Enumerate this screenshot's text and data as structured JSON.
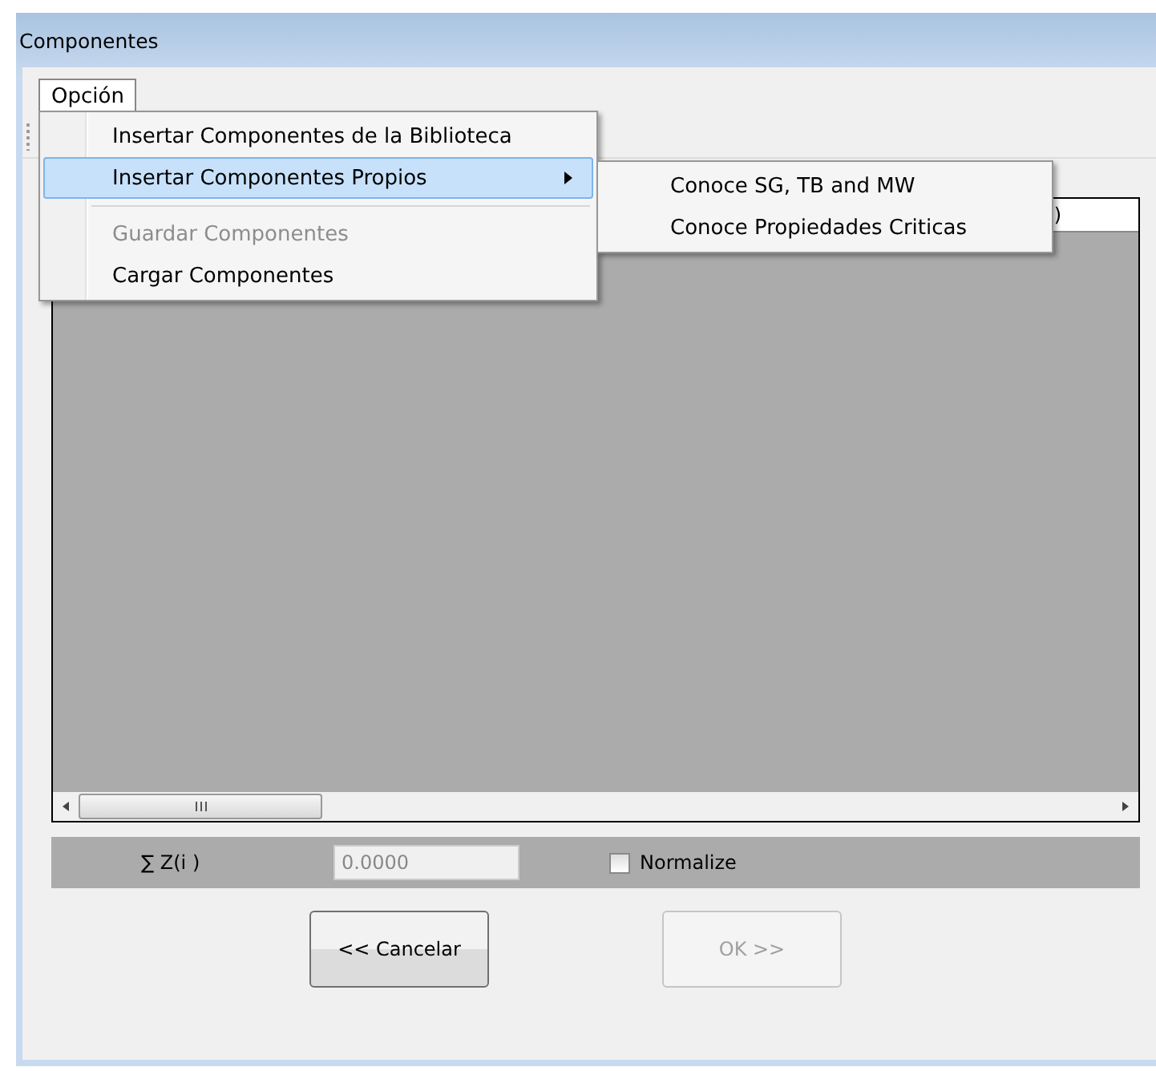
{
  "window": {
    "title": "Componentes"
  },
  "menu_bar": [
    {
      "label": "Opción",
      "expanded": true
    }
  ],
  "menu": [
    {
      "label": "Insertar Componentes de la Biblioteca",
      "kind": "item",
      "disabled": false,
      "selected": false
    },
    {
      "label": "Insertar Componentes Propios",
      "kind": "submenu",
      "disabled": false,
      "selected": true
    },
    {
      "kind": "separator"
    },
    {
      "label": "Guardar Componentes",
      "kind": "item",
      "disabled": true,
      "selected": false
    },
    {
      "label": "Cargar Componentes",
      "kind": "item",
      "disabled": false,
      "selected": false
    }
  ],
  "submenu": [
    {
      "label": "Conoce SG, TB and MW",
      "selected": false,
      "disabled": false
    },
    {
      "label": "Conoce Propiedades Criticas",
      "selected": false,
      "disabled": false
    }
  ],
  "grid": {
    "header_fragment": ")"
  },
  "sum_panel": {
    "label": "∑  Z(i )",
    "value": "0.0000",
    "normalize": {
      "label": "Normalize",
      "checked": false
    }
  },
  "buttons": [
    {
      "label": "<< Cancelar",
      "disabled": false
    },
    {
      "label": "OK >>",
      "disabled": true
    }
  ]
}
